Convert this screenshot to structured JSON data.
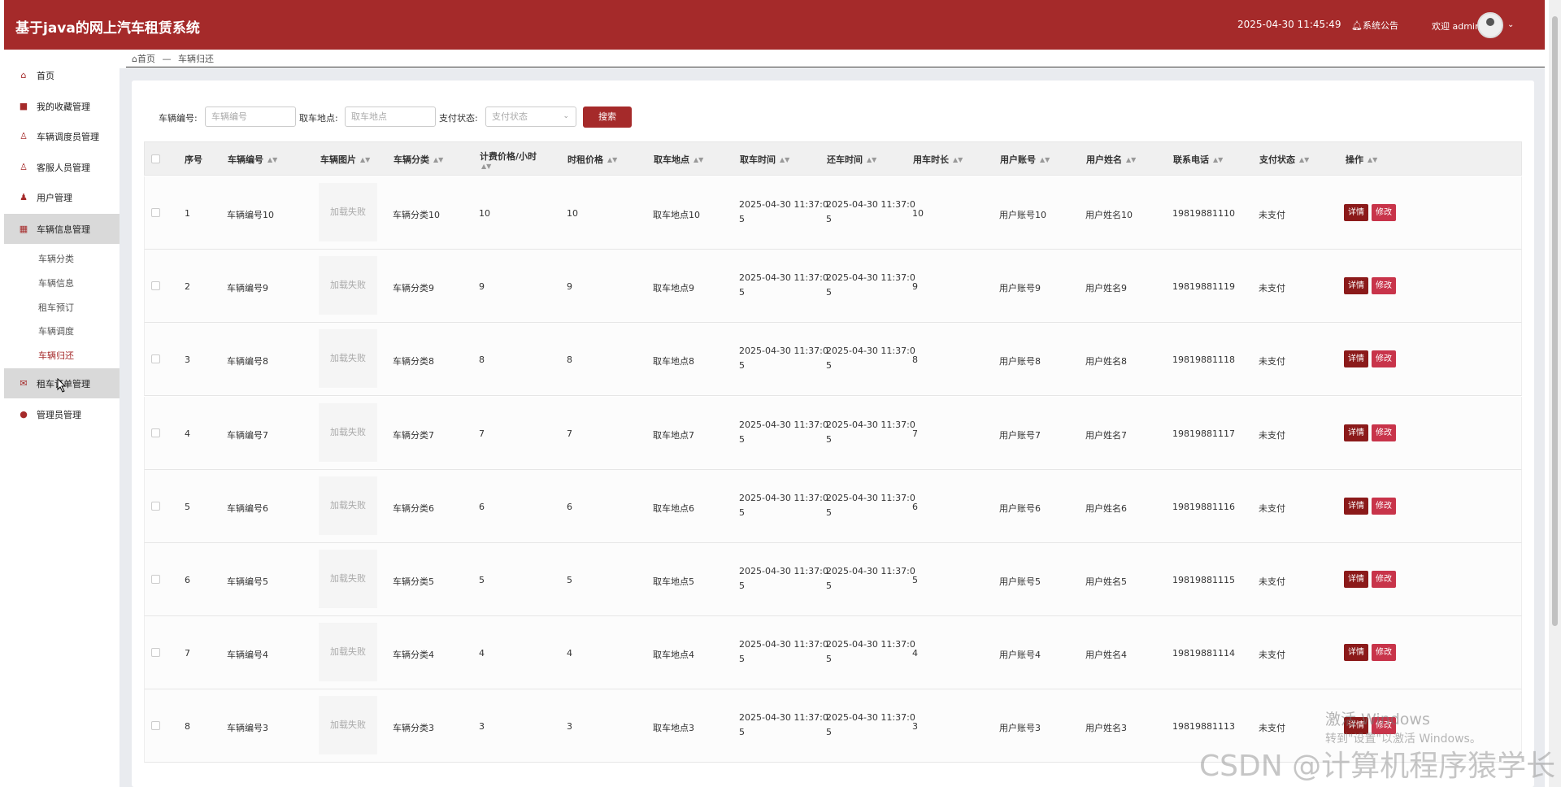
{
  "header": {
    "title": "基于java的网上汽车租赁系统",
    "datetime": "2025-04-30 11:45:49",
    "notice": "系统公告",
    "welcome": "欢迎 admin"
  },
  "sidebar": {
    "items": [
      {
        "label": "首页",
        "icon": "home-icon"
      },
      {
        "label": "我的收藏管理",
        "icon": "collection-icon"
      },
      {
        "label": "车辆调度员管理",
        "icon": "user-icon"
      },
      {
        "label": "客服人员管理",
        "icon": "user-icon"
      },
      {
        "label": "用户管理",
        "icon": "user-icon"
      },
      {
        "label": "车辆信息管理",
        "icon": "grid-icon"
      },
      {
        "label": "租车订单管理",
        "icon": "order-icon"
      },
      {
        "label": "管理员管理",
        "icon": "admin-icon"
      }
    ],
    "subitems": [
      "车辆分类",
      "车辆信息",
      "租车预订",
      "车辆调度",
      "车辆归还"
    ]
  },
  "breadcrumb": {
    "home": "首页",
    "sep": "—",
    "current": "车辆归还"
  },
  "search": {
    "vehicle_no_label": "车辆编号:",
    "vehicle_no_placeholder": "车辆编号",
    "pickup_label": "取车地点:",
    "pickup_placeholder": "取车地点",
    "pay_label": "支付状态:",
    "pay_placeholder": "支付状态",
    "button": "搜索"
  },
  "table": {
    "headers": [
      "序号",
      "车辆编号",
      "车辆图片",
      "车辆分类",
      "计费价格/小时",
      "时租价格",
      "取车地点",
      "取车时间",
      "还车时间",
      "用车时长",
      "用户账号",
      "用户姓名",
      "联系电话",
      "支付状态",
      "操作"
    ],
    "img_failed": "加载失败",
    "detail_label": "详情",
    "edit_label": "修改",
    "rows": [
      {
        "idx": "1",
        "no": "车辆编号10",
        "cat": "车辆分类10",
        "price": "10",
        "hprice": "10",
        "loc": "取车地点10",
        "t1a": "2025-04-30 11:37:0",
        "t1b": "5",
        "t2a": "2025-04-30 11:37:0",
        "t2b": "5",
        "dur": "10",
        "acc": "用户账号10",
        "name": "用户姓名10",
        "phone": "19819881110",
        "pay": "未支付"
      },
      {
        "idx": "2",
        "no": "车辆编号9",
        "cat": "车辆分类9",
        "price": "9",
        "hprice": "9",
        "loc": "取车地点9",
        "t1a": "2025-04-30 11:37:0",
        "t1b": "5",
        "t2a": "2025-04-30 11:37:0",
        "t2b": "5",
        "dur": "9",
        "acc": "用户账号9",
        "name": "用户姓名9",
        "phone": "19819881119",
        "pay": "未支付"
      },
      {
        "idx": "3",
        "no": "车辆编号8",
        "cat": "车辆分类8",
        "price": "8",
        "hprice": "8",
        "loc": "取车地点8",
        "t1a": "2025-04-30 11:37:0",
        "t1b": "5",
        "t2a": "2025-04-30 11:37:0",
        "t2b": "5",
        "dur": "8",
        "acc": "用户账号8",
        "name": "用户姓名8",
        "phone": "19819881118",
        "pay": "未支付"
      },
      {
        "idx": "4",
        "no": "车辆编号7",
        "cat": "车辆分类7",
        "price": "7",
        "hprice": "7",
        "loc": "取车地点7",
        "t1a": "2025-04-30 11:37:0",
        "t1b": "5",
        "t2a": "2025-04-30 11:37:0",
        "t2b": "5",
        "dur": "7",
        "acc": "用户账号7",
        "name": "用户姓名7",
        "phone": "19819881117",
        "pay": "未支付"
      },
      {
        "idx": "5",
        "no": "车辆编号6",
        "cat": "车辆分类6",
        "price": "6",
        "hprice": "6",
        "loc": "取车地点6",
        "t1a": "2025-04-30 11:37:0",
        "t1b": "5",
        "t2a": "2025-04-30 11:37:0",
        "t2b": "5",
        "dur": "6",
        "acc": "用户账号6",
        "name": "用户姓名6",
        "phone": "19819881116",
        "pay": "未支付"
      },
      {
        "idx": "6",
        "no": "车辆编号5",
        "cat": "车辆分类5",
        "price": "5",
        "hprice": "5",
        "loc": "取车地点5",
        "t1a": "2025-04-30 11:37:0",
        "t1b": "5",
        "t2a": "2025-04-30 11:37:0",
        "t2b": "5",
        "dur": "5",
        "acc": "用户账号5",
        "name": "用户姓名5",
        "phone": "19819881115",
        "pay": "未支付"
      },
      {
        "idx": "7",
        "no": "车辆编号4",
        "cat": "车辆分类4",
        "price": "4",
        "hprice": "4",
        "loc": "取车地点4",
        "t1a": "2025-04-30 11:37:0",
        "t1b": "5",
        "t2a": "2025-04-30 11:37:0",
        "t2b": "5",
        "dur": "4",
        "acc": "用户账号4",
        "name": "用户姓名4",
        "phone": "19819881114",
        "pay": "未支付"
      },
      {
        "idx": "8",
        "no": "车辆编号3",
        "cat": "车辆分类3",
        "price": "3",
        "hprice": "3",
        "loc": "取车地点3",
        "t1a": "2025-04-30 11:37:0",
        "t1b": "5",
        "t2a": "2025-04-30 11:37:0",
        "t2b": "5",
        "dur": "3",
        "acc": "用户账号3",
        "name": "用户姓名3",
        "phone": "19819881113",
        "pay": "未支付"
      }
    ]
  },
  "overlay": {
    "win_line1": "激活 Windows",
    "win_line2": "转到\"设置\"以激活 Windows。",
    "csdn": "CSDN @计算机程序猿学长"
  },
  "colors": {
    "accent": "#a52a2a",
    "edit": "#c8344a",
    "detail": "#8b1a1a"
  }
}
